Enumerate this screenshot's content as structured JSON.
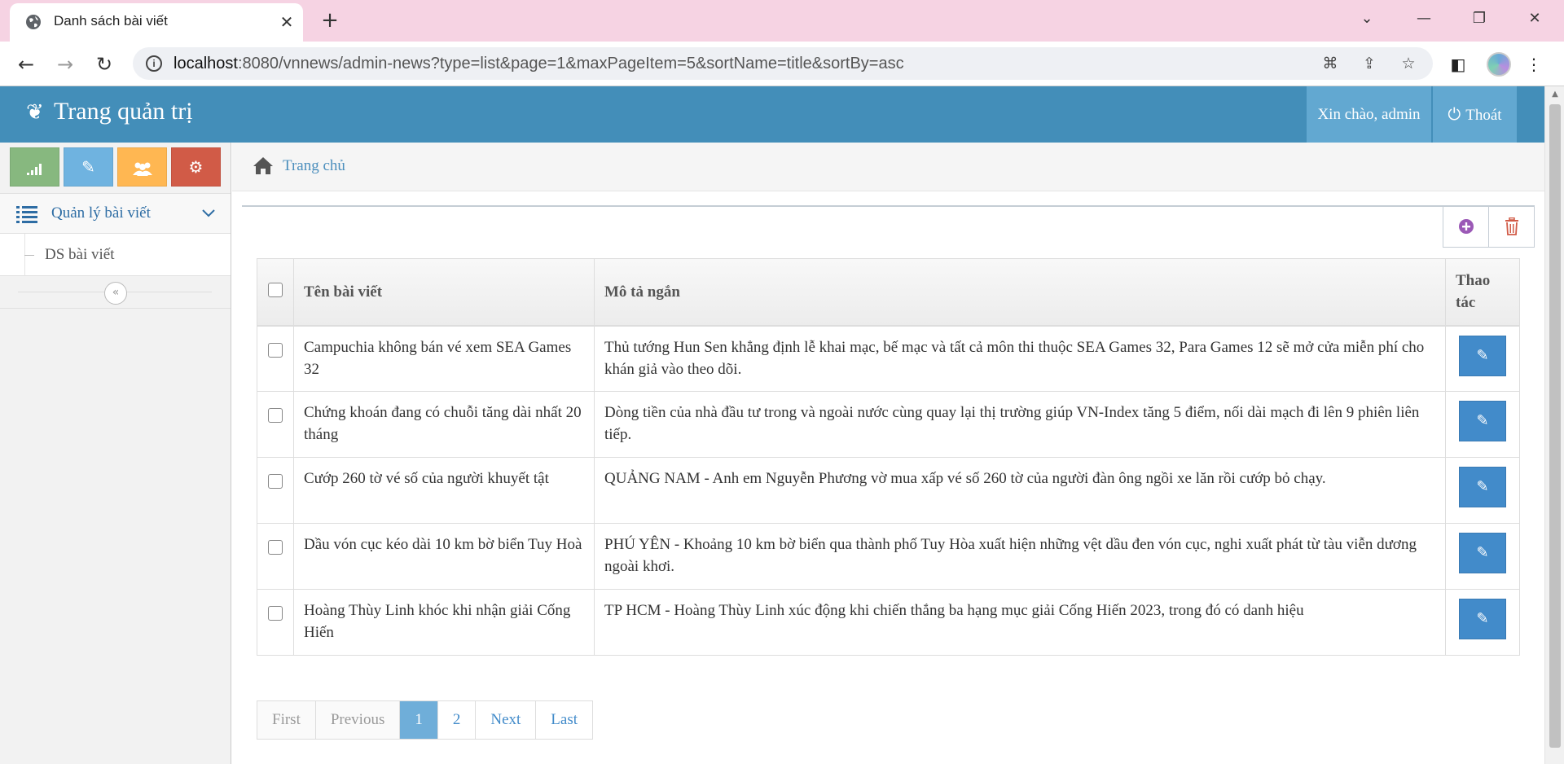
{
  "browser": {
    "tab_title": "Danh sách bài viết",
    "new_tab_symbol": "+",
    "url_host": "localhost",
    "url_rest": ":8080/vnnews/admin-news?type=list&page=1&maxPageItem=5&sortName=title&sortBy=asc"
  },
  "navbar": {
    "brand": "Trang quản trị",
    "greeting": "Xin chào, admin",
    "logout": "Thoát"
  },
  "sidebar": {
    "shortcuts": [
      {
        "name": "signal-icon",
        "color": "#87b87f"
      },
      {
        "name": "pencil-icon",
        "color": "#6fb3e0"
      },
      {
        "name": "users-icon",
        "color": "#ffb752"
      },
      {
        "name": "cogs-icon",
        "color": "#d15b47"
      }
    ],
    "menu_label": "Quản lý bài viết",
    "submenu_label": "DS bài viết"
  },
  "breadcrumb": {
    "home": "Trang chủ"
  },
  "table": {
    "headers": {
      "title": "Tên bài viết",
      "description": "Mô tả ngắn",
      "actions": "Thao tác"
    },
    "rows": [
      {
        "title": "Campuchia không bán vé xem SEA Games 32",
        "description": "Thủ tướng Hun Sen khẳng định lễ khai mạc, bế mạc và tất cả môn thi thuộc SEA Games 32, Para Games 12 sẽ mở cửa miễn phí cho khán giả vào theo dõi."
      },
      {
        "title": "Chứng khoán đang có chuỗi tăng dài nhất 20 tháng",
        "description": "Dòng tiền của nhà đầu tư trong và ngoài nước cùng quay lại thị trường giúp VN-Index tăng 5 điểm, nối dài mạch đi lên 9 phiên liên tiếp."
      },
      {
        "title": "Cướp 260 tờ vé số của người khuyết tật",
        "description": "QUẢNG NAM - Anh em Nguyễn Phương vờ mua xấp vé số 260 tờ của người đàn ông ngồi xe lăn rồi cướp bỏ chạy."
      },
      {
        "title": "Dầu vón cục kéo dài 10 km bờ biển Tuy Hoà",
        "description": "PHÚ YÊN - Khoảng 10 km bờ biển qua thành phố Tuy Hòa xuất hiện những vệt dầu đen vón cục, nghi xuất phát từ tàu viễn dương ngoài khơi."
      },
      {
        "title": "Hoàng Thùy Linh khóc khi nhận giải Cống Hiến",
        "description": "TP HCM - Hoàng Thùy Linh xúc động khi chiến thắng ba hạng mục giải Cống Hiến 2023, trong đó có danh hiệu"
      }
    ]
  },
  "pagination": {
    "first": "First",
    "previous": "Previous",
    "pages": [
      "1",
      "2"
    ],
    "current": "1",
    "next": "Next",
    "last": "Last"
  },
  "colors": {
    "navbar": "#438eb9",
    "link": "#428bca",
    "active_page": "#6faed9",
    "add_icon": "#9b59b6",
    "delete_icon": "#d15b47"
  }
}
